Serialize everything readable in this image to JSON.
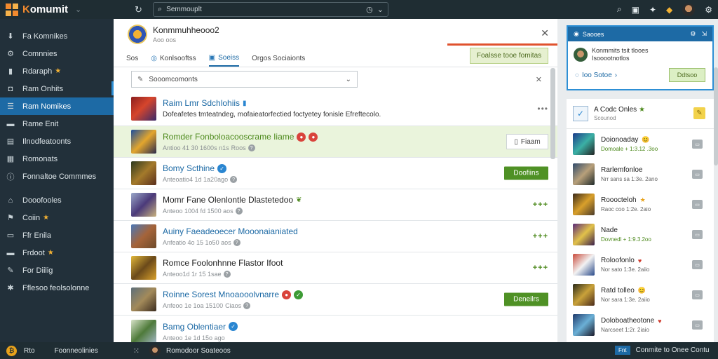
{
  "topbar": {
    "brand": "omumit",
    "brand_prefix": "K",
    "search_placeholder": "Semmouplt",
    "icons": [
      "search-icon",
      "bookmark-icon",
      "plugin-icon",
      "notification-icon",
      "avatar"
    ]
  },
  "sidebar": {
    "items": [
      {
        "icon": "download-icon",
        "label": "Fa Komnikes",
        "tag": ""
      },
      {
        "icon": "gear-icon",
        "label": "Comnnies",
        "tag": ""
      },
      {
        "icon": "chart-icon",
        "label": "Rdaraph",
        "tag": "★"
      },
      {
        "icon": "chat-icon",
        "label": "Ram Onhits",
        "tag": ""
      },
      {
        "icon": "list-icon",
        "label": "Ram Nomikes",
        "tag": "",
        "active": true
      },
      {
        "icon": "folder-icon",
        "label": "Rame Enit",
        "tag": ""
      },
      {
        "icon": "folder-icon",
        "label": "Ilnodfeatoonts",
        "tag": ""
      },
      {
        "icon": "box-icon",
        "label": "Romonats",
        "tag": ""
      },
      {
        "icon": "info-icon",
        "label": "Fonnaltoe Commmes",
        "tag": ""
      }
    ],
    "items2": [
      {
        "icon": "user-icon",
        "label": "Dooofooles",
        "tag": ""
      },
      {
        "icon": "flag-icon",
        "label": "Coiin",
        "tag": "★"
      },
      {
        "icon": "doc-icon",
        "label": "Ffr Enila",
        "tag": ""
      },
      {
        "icon": "folder-icon",
        "label": "Frdoot",
        "tag": "★"
      },
      {
        "icon": "tool-icon",
        "label": "For Diilig",
        "tag": ""
      },
      {
        "icon": "gear-icon",
        "label": "Fflesoo feolsolonne",
        "tag": ""
      }
    ]
  },
  "main": {
    "title": "Konmmuhheooo2",
    "subtitle": "Aoo oos",
    "notify_label": "Foalsse tooe fomitas",
    "tabs": [
      {
        "label": "Sos",
        "active": false
      },
      {
        "label": "Konlsooftss",
        "active": false
      },
      {
        "label": "Soeiss",
        "active": true
      },
      {
        "label": "Orgos Sociaionts",
        "active": false
      }
    ],
    "filter_placeholder": "Sooomcomonts",
    "first_row": {
      "title": "Raim Lmr Sdchlohiis",
      "desc": "Dofeafetes tmteatndeg, mofaieatorfectied foctyetey fonisle Efreftecolo."
    },
    "rows": [
      {
        "title": "Romder Fonboloacooscrame Iiame",
        "meta": "Antioo 41 30 1600s n1s",
        "meta2": "Roos",
        "style": "green",
        "badges": [
          "red",
          "red"
        ],
        "action": "white",
        "action_label": "Fiaam"
      },
      {
        "title": "Bomy Scthine",
        "meta": "Anteoatio4 1d 1a20ago",
        "meta2": "",
        "style": "blue",
        "badges": [
          "blue"
        ],
        "action": "green",
        "action_label": "Doofiins"
      },
      {
        "title": "Momr Fane Olenlontle Dlastetedoo",
        "meta": "Anteoo 1004 fd 1500 aos",
        "meta2": "",
        "style": "dark",
        "badges": [
          "leaf"
        ],
        "action": "plus",
        "action_label": "+++"
      },
      {
        "title": "Auiny Faeadeoecer Mooonaianiated",
        "meta": "Anfeatio 4o 15 1o50 aos",
        "meta2": "",
        "style": "blue",
        "badges": [],
        "action": "plus",
        "action_label": "+++"
      },
      {
        "title": "Romce Foolonhnne Flastor Ifoot",
        "meta": "Anteoo1d 1r 15 1sae",
        "meta2": "",
        "style": "dark",
        "badges": [],
        "action": "plus",
        "action_label": "+++"
      },
      {
        "title": "Roinne Sorest Mnoaooolvnarre",
        "meta": "Anfeoo 1e 1oa 15100",
        "meta2": "Ciaos",
        "style": "blue",
        "badges": [
          "red",
          "green"
        ],
        "action": "green",
        "action_label": "Deneilrs"
      },
      {
        "title": "Bamg Oblentiaer",
        "meta": "Anteoo 1e 1d 15o ago",
        "meta2": "",
        "style": "blue",
        "badges": [
          "blue"
        ],
        "action": "none",
        "action_label": ""
      }
    ]
  },
  "right_card": {
    "header": "Saooes",
    "user_line1": "Konmmits tsit tlooes",
    "user_line2": "Isooootnotlos",
    "footer_link": "Ioo Sotoe",
    "button": "Ddtsoo"
  },
  "right_list": {
    "top_title": "A Codc Onles",
    "top_sub": "Scounod",
    "items": [
      {
        "title": "Doionoaday",
        "sub": "Domoale + 1:3.12 .3oo",
        "green": true,
        "mark": "😊"
      },
      {
        "title": "Rarlemfonloe",
        "sub": "Nrr sans sa 1:3e. 2ano",
        "green": false,
        "mark": ""
      },
      {
        "title": "Rooocteloh",
        "sub": "Raoc coo 1:2e. 2aio",
        "green": false,
        "mark": "★"
      },
      {
        "title": "Nade",
        "sub": "Dovnedl + 1:9.3.2oo",
        "green": true,
        "mark": ""
      },
      {
        "title": "Roloofonlo",
        "sub": "Nor sato 1:3e. 2aiio",
        "green": false,
        "mark": "♥"
      },
      {
        "title": "Ratd tolleo",
        "sub": "Nor sara 1:3e. 2aiio",
        "green": false,
        "mark": "😊"
      },
      {
        "title": "Doloboatheotone",
        "sub": "Narcseet 1:2r. 2iaio",
        "green": false,
        "mark": "♥"
      }
    ]
  },
  "bottombar": {
    "coin": "₿",
    "label1": "Rto",
    "label2": "Foonneolinies",
    "user": "Romodoor Soateoos",
    "chip": "Fnt",
    "status": "Conmite to Onee Contu"
  }
}
